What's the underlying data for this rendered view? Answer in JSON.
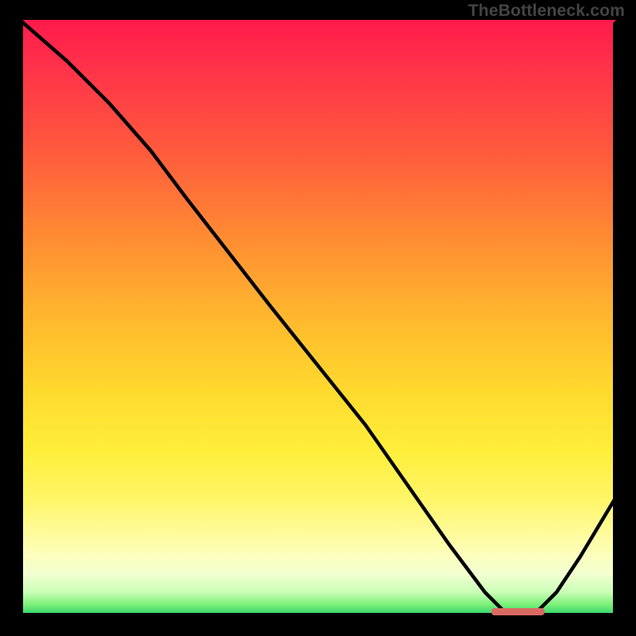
{
  "watermark": "TheBottleneck.com",
  "colors": {
    "background": "#000000",
    "curve": "#000000",
    "marker": "#d96a62",
    "gradient_top": "#ff1a4b",
    "gradient_bottom": "#24cf6b"
  },
  "chart_data": {
    "type": "line",
    "title": "",
    "xlabel": "",
    "ylabel": "",
    "xlim": [
      0,
      100
    ],
    "ylim": [
      0,
      100
    ],
    "grid": false,
    "legend": false,
    "series": [
      {
        "name": "bottleneck-curve",
        "x": [
          0,
          8,
          15,
          22,
          28,
          35,
          42,
          50,
          58,
          65,
          72,
          78,
          82,
          86,
          90,
          94,
          100
        ],
        "values": [
          100,
          93,
          86,
          78,
          70,
          61,
          52,
          42,
          32,
          22,
          12,
          4,
          0,
          0,
          4,
          10,
          20
        ]
      }
    ],
    "annotations": [
      {
        "name": "optimal-band",
        "x_start": 79,
        "x_end": 88,
        "y": 0
      }
    ],
    "background_gradient": {
      "axis": "y",
      "stops": [
        {
          "pos": 0,
          "color": "#24cf6b"
        },
        {
          "pos": 50,
          "color": "#ffd92e"
        },
        {
          "pos": 100,
          "color": "#ff1a4b"
        }
      ]
    }
  }
}
